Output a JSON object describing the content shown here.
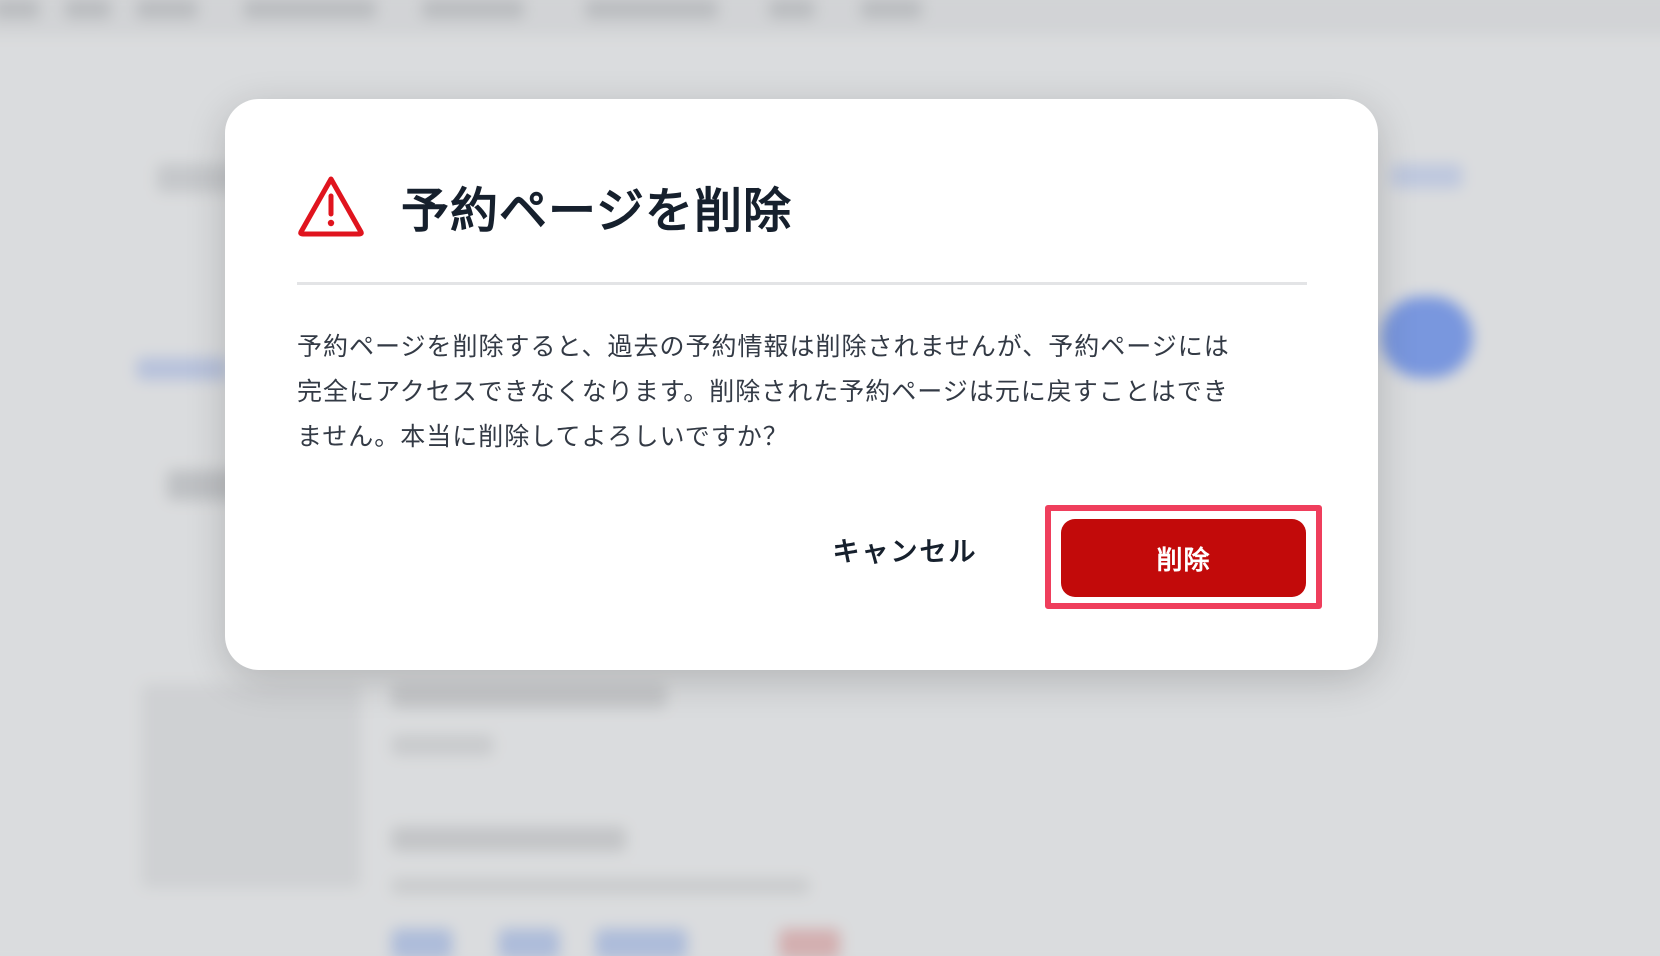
{
  "dialog": {
    "title": "予約ページを削除",
    "message_lines": [
      "予約ページを削除すると、過去の予約情報は削除されませんが、予約ページには",
      "完全にアクセスできなくなります。削除された予約ページは元に戻すことはでき",
      "ません。本当に削除してよろしいですか？"
    ],
    "cancel_label": "キャンセル",
    "delete_label": "削除",
    "icon": "warning-triangle-icon"
  },
  "colors": {
    "danger": "#c20a0a",
    "warning_icon": "#e0141e",
    "highlight": "#ef3e5c",
    "title": "#16202d",
    "body_text": "#333a45"
  }
}
